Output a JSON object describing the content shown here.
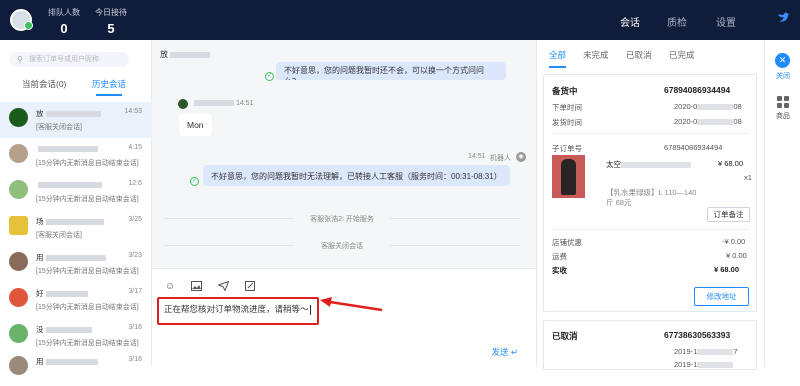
{
  "header": {
    "stats": [
      {
        "label": "排队人数",
        "value": "0"
      },
      {
        "label": "今日接待",
        "value": "5"
      }
    ],
    "nav": [
      "会话",
      "质检",
      "设置"
    ],
    "active_nav": "会话"
  },
  "sidebar": {
    "search_placeholder": "搜索订单号或用户昵称",
    "tabs": [
      "当前会话(0)",
      "历史会话"
    ],
    "items": [
      {
        "name": "放",
        "time": "14:53",
        "msg": "[客服关闭会话]",
        "avatar_color": "#1a5c1a"
      },
      {
        "name": "",
        "time": "4:15",
        "msg": "[15分钟内无新消息自动结束会话]",
        "avatar_color": "#b7a08a"
      },
      {
        "name": "",
        "time": "12:6",
        "msg": "[15分钟内无新消息自动结束会话]",
        "avatar_color": "#8fbf7a"
      },
      {
        "name": "场",
        "time": "3/25",
        "msg": "[客服关闭会话]",
        "avatar_color": "#e6c23a"
      },
      {
        "name": "用",
        "time": "3/23",
        "msg": "[15分钟内无新消息自动结束会话]",
        "avatar_color": "#8a6b5a"
      },
      {
        "name": "好",
        "time": "3/17",
        "msg": "[15分钟内无新消息自动结束会话]",
        "avatar_color": "#e0563a"
      },
      {
        "name": "没",
        "time": "3/16",
        "msg": "[15分钟内无新消息自动结束会话]",
        "avatar_color": "#6ab36a"
      },
      {
        "name": "用",
        "time": "3/16",
        "msg": "",
        "avatar_color": "#9a8a7a"
      }
    ]
  },
  "chat": {
    "header_name": "放",
    "msg1": "不好意思，您的问题我暂时还不会，可以换一个方式问问么？",
    "user_time": "14:51",
    "user_msg": "Mon",
    "bot_time": "14:51",
    "bot_label": "机器人",
    "msg2": "不好意思，您的问题我暂时无法理解，已转接人工客服（服务时间：00:31-08:31）",
    "sys1": "客服张浩2: 开始服务",
    "sys2": "客服关闭会话",
    "input_text": "正在帮您核对订单物流进度，请稍等～",
    "send_label": "发送"
  },
  "orders": {
    "tabs": [
      "全部",
      "未完成",
      "已取消",
      "已完成"
    ],
    "order1": {
      "status": "备货中",
      "order_no": "67894086934494",
      "order_time_label": "下单时间",
      "order_time": "2020-0",
      "order_time_tail": "08",
      "ship_time_label": "发货时间",
      "ship_time": "2020-0",
      "ship_time_tail": "08",
      "sub_label": "子订单号",
      "sub_no": "67894086934494",
      "product_name": "太空",
      "price": "¥ 68.00",
      "qty": "x1",
      "spec": "【乳水果绿级】L 110—140",
      "spec2": "斤 68元",
      "remark_btn": "订单备注",
      "discount_label": "店铺优惠",
      "discount": "-¥ 0.00",
      "shipping_label": "运费",
      "shipping": "¥ 0.00",
      "paid_label": "实收",
      "paid": "¥ 68.00",
      "modify_btn": "修改地址"
    },
    "order2": {
      "status": "已取消",
      "order_no": "67738630563393",
      "time1": "2019-1",
      "time1_tail": "7",
      "time2": "2019-1"
    }
  },
  "rail": {
    "close_label": "关闭",
    "goods_label": "商品"
  }
}
